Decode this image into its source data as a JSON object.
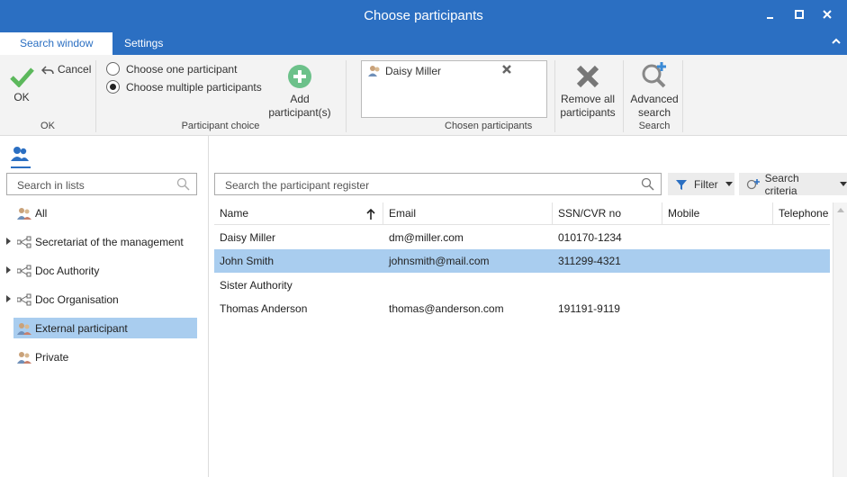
{
  "window": {
    "title": "Choose participants"
  },
  "tabs": [
    {
      "label": "Search window",
      "active": true
    },
    {
      "label": "Settings",
      "active": false
    }
  ],
  "ribbon": {
    "ok_label": "OK",
    "cancel_label": "Cancel",
    "ok_group_label": "OK",
    "radio_one_label": "Choose one participant",
    "radio_multiple_label": "Choose multiple participants",
    "selected_choice": "multiple",
    "add_label_1": "Add",
    "add_label_2": "participant(s)",
    "participant_choice_group_label": "Participant choice",
    "chosen": [
      {
        "name": "Daisy Miller"
      }
    ],
    "chosen_group_label": "Chosen participants",
    "remove_all_label_1": "Remove all",
    "remove_all_label_2": "participants",
    "advanced_label_1": "Advanced",
    "advanced_label_2": "search",
    "search_group_label": "Search"
  },
  "left_panel": {
    "search_placeholder": "Search in lists",
    "items": [
      {
        "label": "All",
        "expandable": false,
        "selected": false,
        "icon": "people-icon"
      },
      {
        "label": "Secretariat of the management",
        "expandable": true,
        "selected": false,
        "icon": "network-icon"
      },
      {
        "label": "Doc Authority",
        "expandable": true,
        "selected": false,
        "icon": "network-icon"
      },
      {
        "label": "Doc Organisation",
        "expandable": true,
        "selected": false,
        "icon": "network-icon"
      },
      {
        "label": "External participant",
        "expandable": false,
        "selected": true,
        "icon": "people-icon"
      },
      {
        "label": "Private",
        "expandable": false,
        "selected": false,
        "icon": "people-icon"
      }
    ]
  },
  "main": {
    "search_placeholder": "Search the participant register",
    "filter_label": "Filter",
    "criteria_label": "Search criteria",
    "columns": [
      "Name",
      "Email",
      "SSN/CVR no",
      "Mobile",
      "Telephone"
    ],
    "sort_column": "Name",
    "rows": [
      {
        "name": "Daisy Miller",
        "email": "dm@miller.com",
        "ssn": "010170-1234",
        "mobile": "",
        "telephone": "",
        "selected": false
      },
      {
        "name": "John Smith",
        "email": "johnsmith@mail.com",
        "ssn": "311299-4321",
        "mobile": "",
        "telephone": "",
        "selected": true
      },
      {
        "name": "Sister Authority",
        "email": "",
        "ssn": "",
        "mobile": "",
        "telephone": "",
        "selected": false
      },
      {
        "name": "Thomas Anderson",
        "email": "thomas@anderson.com",
        "ssn": "191191-9119",
        "mobile": "",
        "telephone": "",
        "selected": false
      }
    ]
  },
  "colors": {
    "accent": "#2b6fc2",
    "selection": "#a9cdef",
    "ok_green": "#5cb85c",
    "add_green": "#6cc18a"
  }
}
